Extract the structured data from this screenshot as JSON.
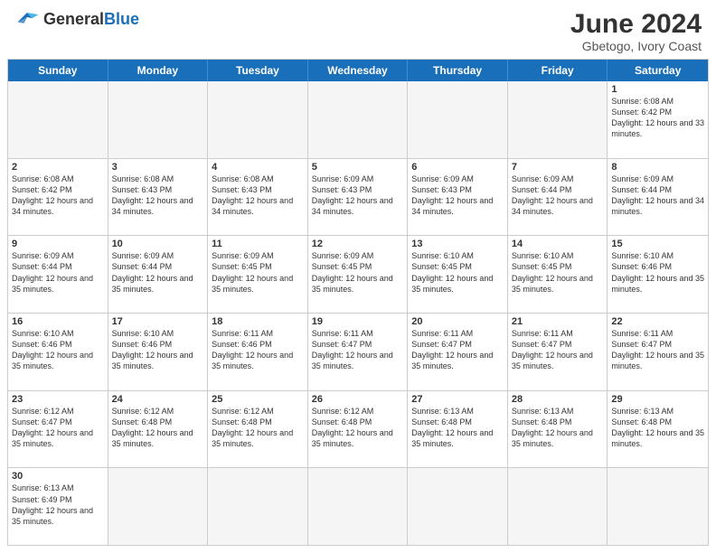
{
  "header": {
    "logo_general": "General",
    "logo_blue": "Blue",
    "month_title": "June 2024",
    "location": "Gbetogo, Ivory Coast"
  },
  "day_headers": [
    "Sunday",
    "Monday",
    "Tuesday",
    "Wednesday",
    "Thursday",
    "Friday",
    "Saturday"
  ],
  "weeks": [
    [
      {
        "num": "",
        "info": ""
      },
      {
        "num": "",
        "info": ""
      },
      {
        "num": "",
        "info": ""
      },
      {
        "num": "",
        "info": ""
      },
      {
        "num": "",
        "info": ""
      },
      {
        "num": "",
        "info": ""
      },
      {
        "num": "1",
        "info": "Sunrise: 6:08 AM\nSunset: 6:42 PM\nDaylight: 12 hours and 33 minutes."
      }
    ],
    [
      {
        "num": "2",
        "info": "Sunrise: 6:08 AM\nSunset: 6:42 PM\nDaylight: 12 hours and 34 minutes."
      },
      {
        "num": "3",
        "info": "Sunrise: 6:08 AM\nSunset: 6:43 PM\nDaylight: 12 hours and 34 minutes."
      },
      {
        "num": "4",
        "info": "Sunrise: 6:08 AM\nSunset: 6:43 PM\nDaylight: 12 hours and 34 minutes."
      },
      {
        "num": "5",
        "info": "Sunrise: 6:09 AM\nSunset: 6:43 PM\nDaylight: 12 hours and 34 minutes."
      },
      {
        "num": "6",
        "info": "Sunrise: 6:09 AM\nSunset: 6:43 PM\nDaylight: 12 hours and 34 minutes."
      },
      {
        "num": "7",
        "info": "Sunrise: 6:09 AM\nSunset: 6:44 PM\nDaylight: 12 hours and 34 minutes."
      },
      {
        "num": "8",
        "info": "Sunrise: 6:09 AM\nSunset: 6:44 PM\nDaylight: 12 hours and 34 minutes."
      }
    ],
    [
      {
        "num": "9",
        "info": "Sunrise: 6:09 AM\nSunset: 6:44 PM\nDaylight: 12 hours and 35 minutes."
      },
      {
        "num": "10",
        "info": "Sunrise: 6:09 AM\nSunset: 6:44 PM\nDaylight: 12 hours and 35 minutes."
      },
      {
        "num": "11",
        "info": "Sunrise: 6:09 AM\nSunset: 6:45 PM\nDaylight: 12 hours and 35 minutes."
      },
      {
        "num": "12",
        "info": "Sunrise: 6:09 AM\nSunset: 6:45 PM\nDaylight: 12 hours and 35 minutes."
      },
      {
        "num": "13",
        "info": "Sunrise: 6:10 AM\nSunset: 6:45 PM\nDaylight: 12 hours and 35 minutes."
      },
      {
        "num": "14",
        "info": "Sunrise: 6:10 AM\nSunset: 6:45 PM\nDaylight: 12 hours and 35 minutes."
      },
      {
        "num": "15",
        "info": "Sunrise: 6:10 AM\nSunset: 6:46 PM\nDaylight: 12 hours and 35 minutes."
      }
    ],
    [
      {
        "num": "16",
        "info": "Sunrise: 6:10 AM\nSunset: 6:46 PM\nDaylight: 12 hours and 35 minutes."
      },
      {
        "num": "17",
        "info": "Sunrise: 6:10 AM\nSunset: 6:46 PM\nDaylight: 12 hours and 35 minutes."
      },
      {
        "num": "18",
        "info": "Sunrise: 6:11 AM\nSunset: 6:46 PM\nDaylight: 12 hours and 35 minutes."
      },
      {
        "num": "19",
        "info": "Sunrise: 6:11 AM\nSunset: 6:47 PM\nDaylight: 12 hours and 35 minutes."
      },
      {
        "num": "20",
        "info": "Sunrise: 6:11 AM\nSunset: 6:47 PM\nDaylight: 12 hours and 35 minutes."
      },
      {
        "num": "21",
        "info": "Sunrise: 6:11 AM\nSunset: 6:47 PM\nDaylight: 12 hours and 35 minutes."
      },
      {
        "num": "22",
        "info": "Sunrise: 6:11 AM\nSunset: 6:47 PM\nDaylight: 12 hours and 35 minutes."
      }
    ],
    [
      {
        "num": "23",
        "info": "Sunrise: 6:12 AM\nSunset: 6:47 PM\nDaylight: 12 hours and 35 minutes."
      },
      {
        "num": "24",
        "info": "Sunrise: 6:12 AM\nSunset: 6:48 PM\nDaylight: 12 hours and 35 minutes."
      },
      {
        "num": "25",
        "info": "Sunrise: 6:12 AM\nSunset: 6:48 PM\nDaylight: 12 hours and 35 minutes."
      },
      {
        "num": "26",
        "info": "Sunrise: 6:12 AM\nSunset: 6:48 PM\nDaylight: 12 hours and 35 minutes."
      },
      {
        "num": "27",
        "info": "Sunrise: 6:13 AM\nSunset: 6:48 PM\nDaylight: 12 hours and 35 minutes."
      },
      {
        "num": "28",
        "info": "Sunrise: 6:13 AM\nSunset: 6:48 PM\nDaylight: 12 hours and 35 minutes."
      },
      {
        "num": "29",
        "info": "Sunrise: 6:13 AM\nSunset: 6:48 PM\nDaylight: 12 hours and 35 minutes."
      }
    ],
    [
      {
        "num": "30",
        "info": "Sunrise: 6:13 AM\nSunset: 6:49 PM\nDaylight: 12 hours and 35 minutes."
      },
      {
        "num": "",
        "info": ""
      },
      {
        "num": "",
        "info": ""
      },
      {
        "num": "",
        "info": ""
      },
      {
        "num": "",
        "info": ""
      },
      {
        "num": "",
        "info": ""
      },
      {
        "num": "",
        "info": ""
      }
    ]
  ]
}
